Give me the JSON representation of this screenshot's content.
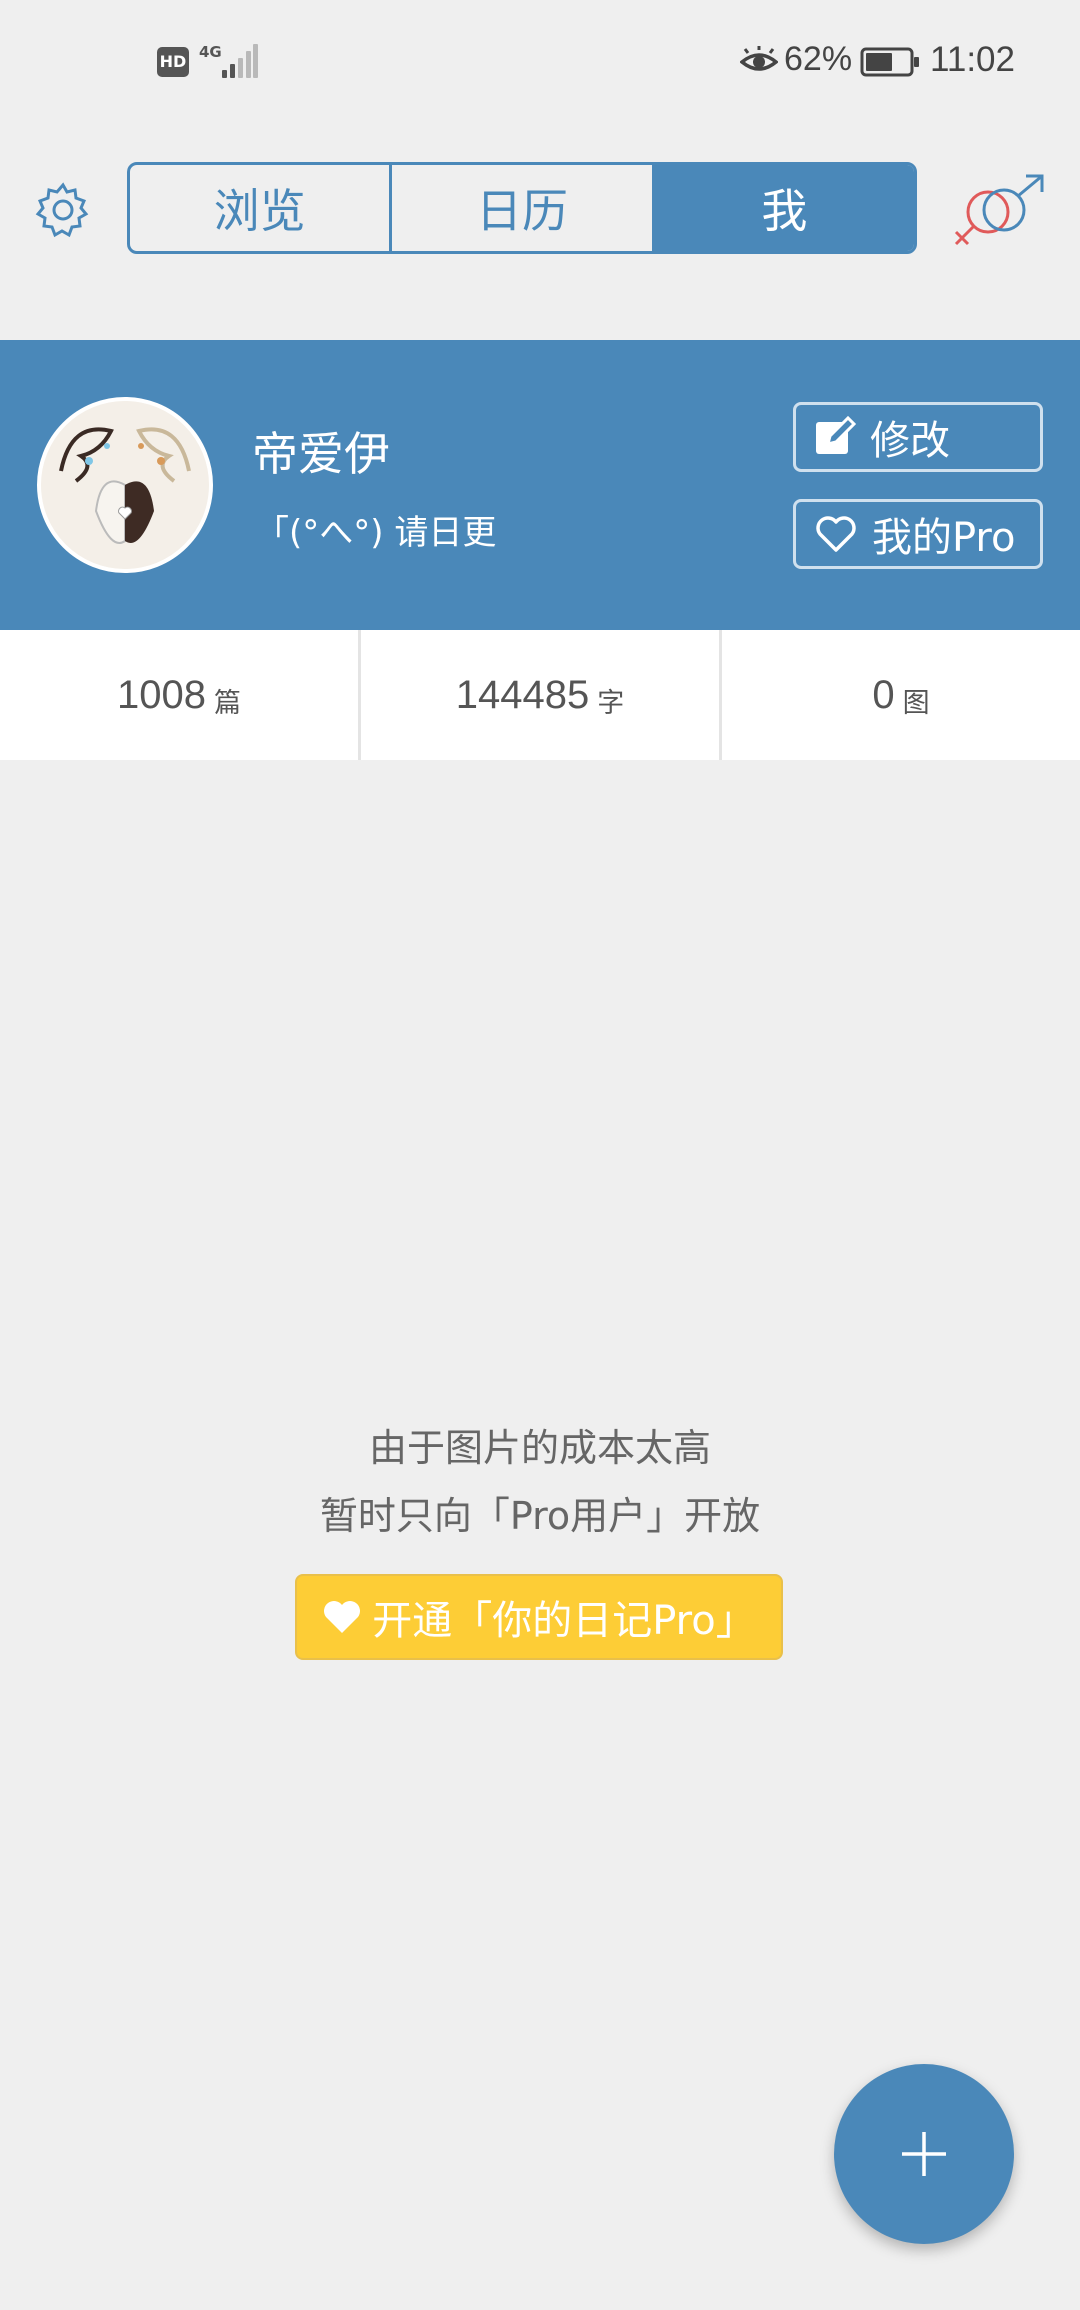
{
  "status_bar": {
    "hd": "HD",
    "network": "4G",
    "battery_percent": "62%",
    "time": "11:02",
    "battery_level": 0.62
  },
  "nav": {
    "tabs": [
      {
        "label": "浏览",
        "active": false
      },
      {
        "label": "日历",
        "active": false
      },
      {
        "label": "我",
        "active": true
      }
    ],
    "settings_icon": "gear-icon",
    "gender_icon": "gender-symbol-icon"
  },
  "profile": {
    "name": "帝爱伊",
    "bio": "「(°へ°) 请日更",
    "edit_label": "修改",
    "pro_label": "我的Pro"
  },
  "stats": [
    {
      "value": "1008",
      "unit": "篇"
    },
    {
      "value": "144485",
      "unit": "字"
    },
    {
      "value": "0",
      "unit": "图"
    }
  ],
  "notice": {
    "line1": "由于图片的成本太高",
    "line2": "暂时只向「Pro用户」开放",
    "cta_label": "开通「你的日记Pro」"
  },
  "colors": {
    "primary": "#4a88b9",
    "cta": "#fdcd36",
    "female_symbol": "#e05a5a"
  }
}
